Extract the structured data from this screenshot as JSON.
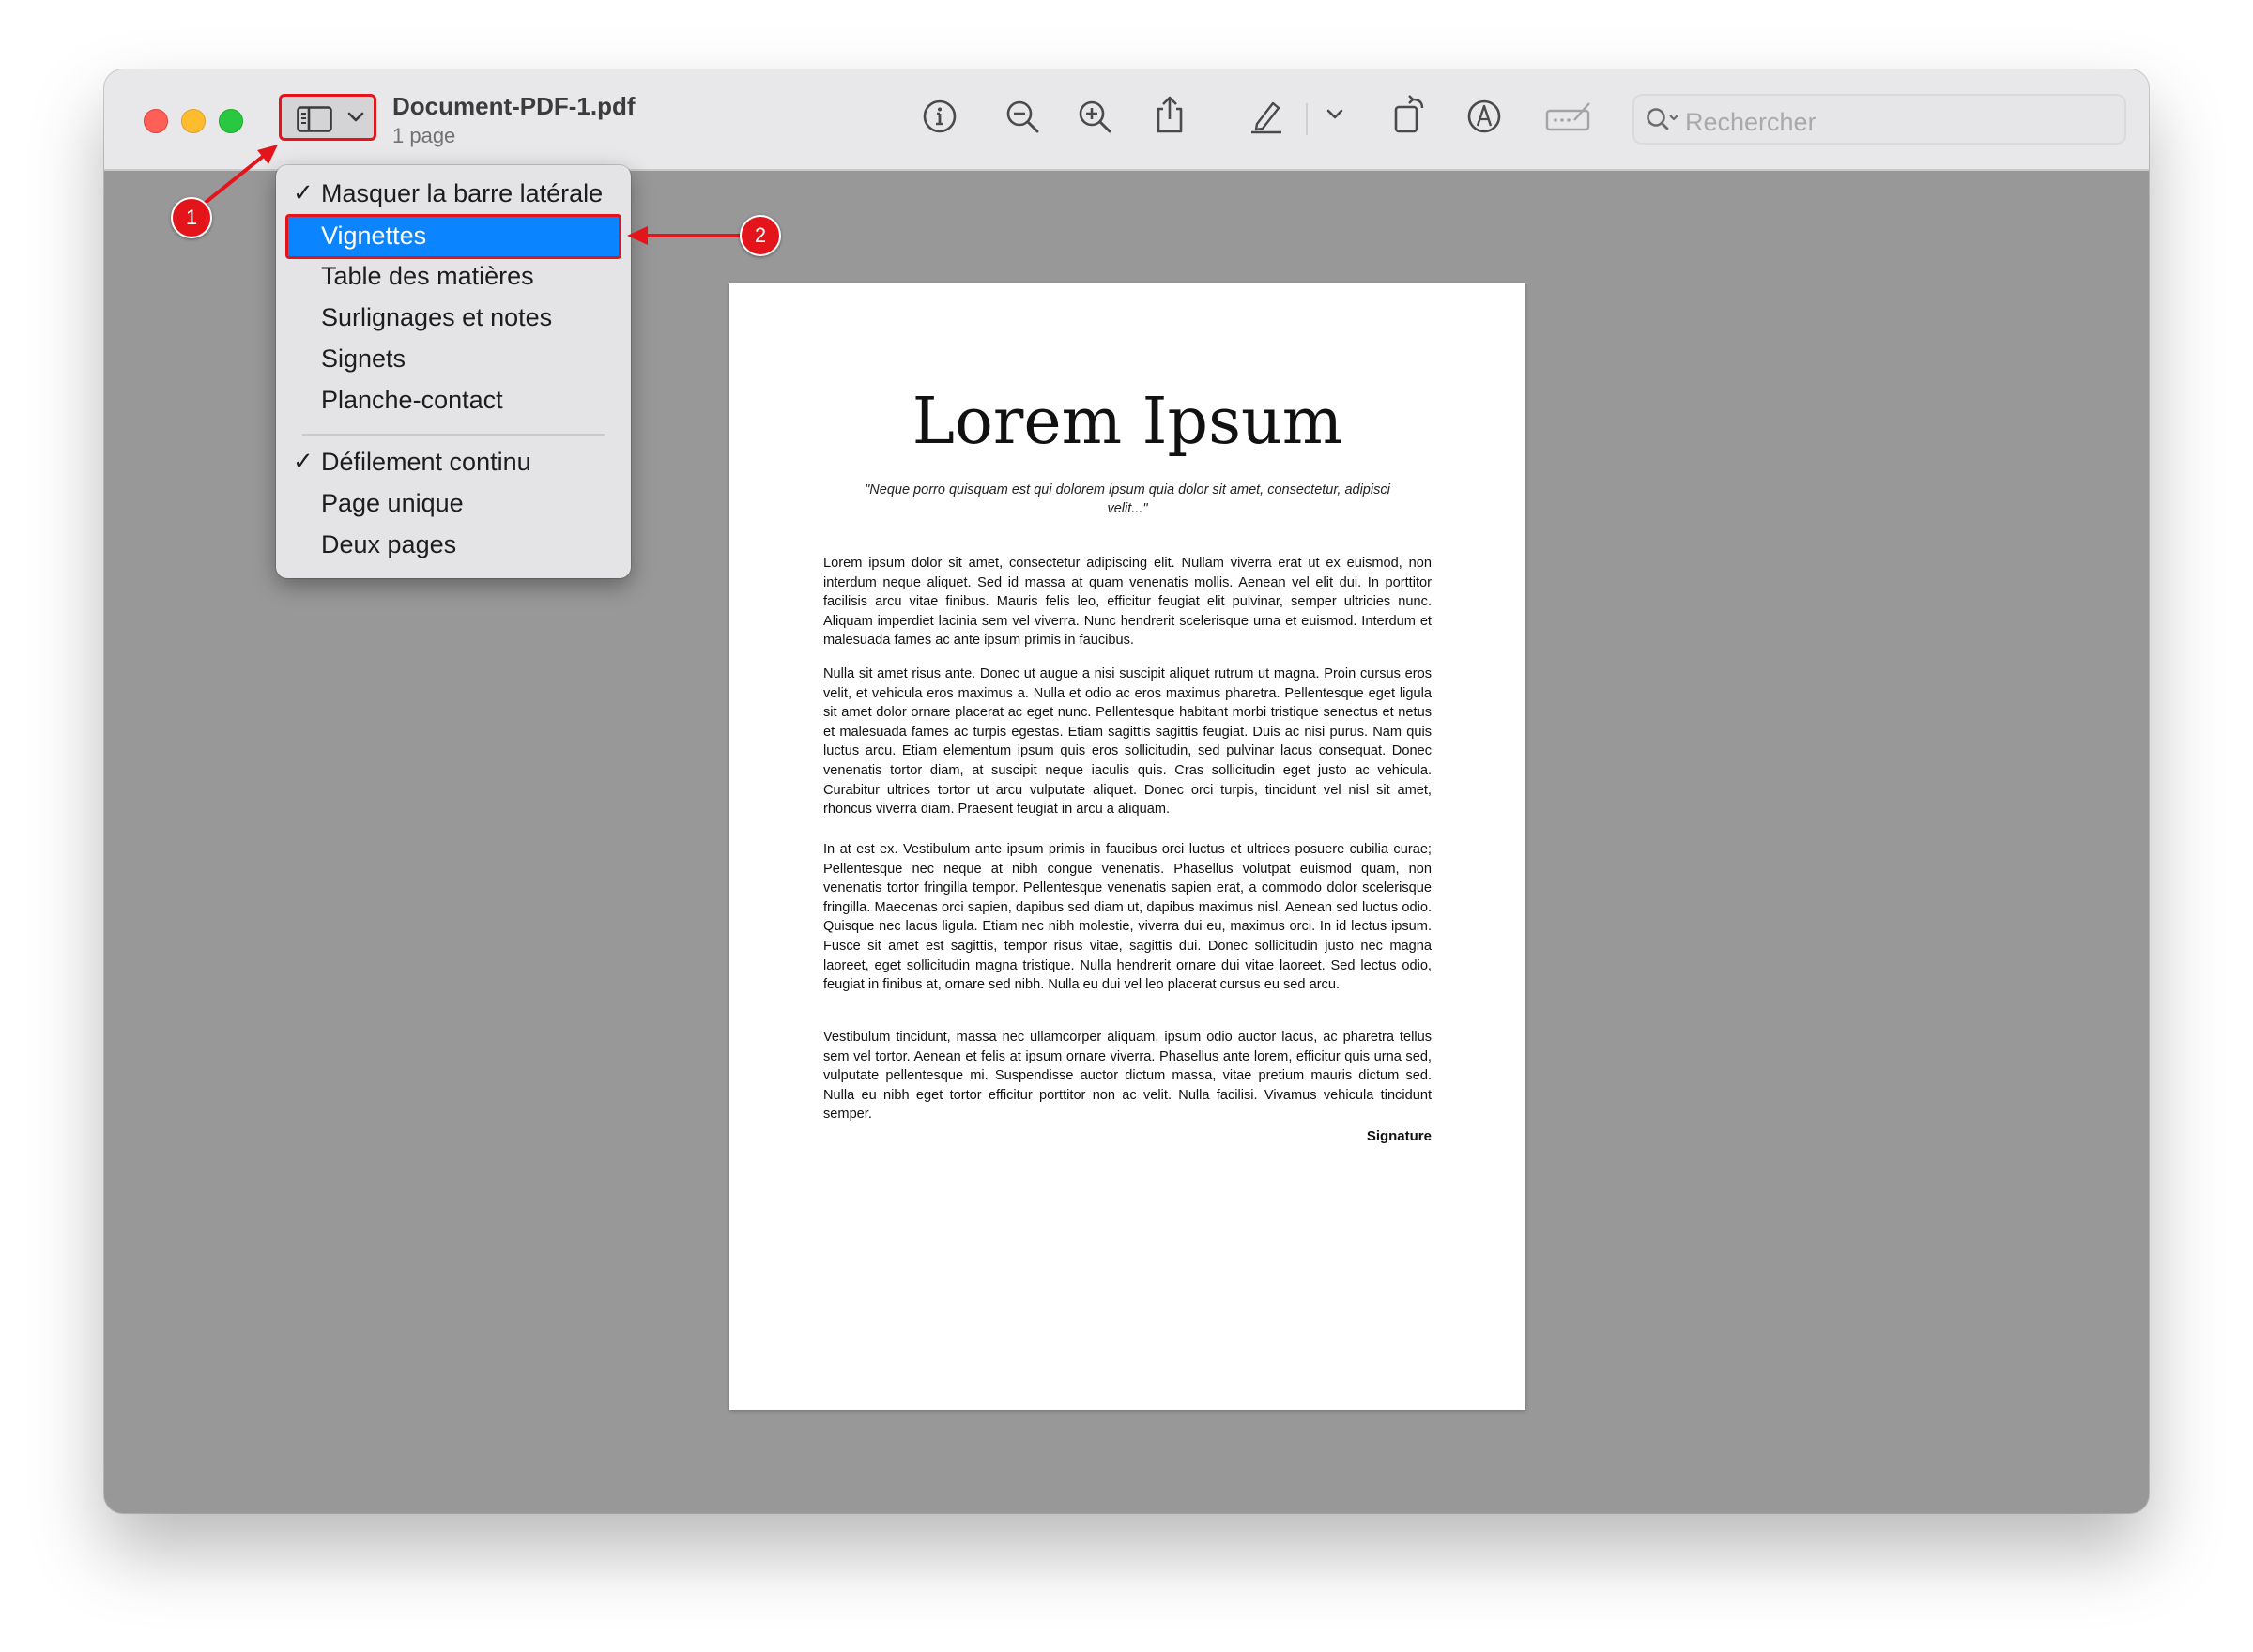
{
  "window": {
    "title": "Document-PDF-1.pdf",
    "subtitle": "1 page"
  },
  "toolbar": {
    "icons": [
      "sidebar-icon",
      "info-icon",
      "zoom-out-icon",
      "zoom-in-icon",
      "share-icon",
      "highlight-icon",
      "rotate-icon",
      "markup-icon",
      "signature-icon",
      "search-icon"
    ],
    "search_placeholder": "Rechercher"
  },
  "menu": {
    "items": [
      {
        "label": "Masquer la barre latérale",
        "checked": true
      },
      {
        "label": "Vignettes",
        "highlighted": true
      },
      {
        "label": "Table des matières"
      },
      {
        "label": "Surlignages et notes"
      },
      {
        "label": "Signets"
      },
      {
        "label": "Planche-contact"
      },
      {
        "label": "Défilement continu",
        "checked": true
      },
      {
        "label": "Page unique"
      },
      {
        "label": "Deux pages"
      }
    ],
    "check_glyph": "✓"
  },
  "document": {
    "title": "Lorem Ipsum",
    "quote": "\"Neque porro quisquam est qui dolorem ipsum quia dolor sit amet, consectetur, adipisci velit...\"",
    "paragraphs": [
      "Lorem ipsum dolor sit amet, consectetur adipiscing elit. Nullam viverra erat ut ex euismod, non interdum neque aliquet. Sed id massa at quam venenatis mollis. Aenean vel elit dui. In porttitor facilisis arcu vitae finibus. Mauris felis leo, efficitur feugiat elit pulvinar, semper ultricies nunc. Aliquam imperdiet lacinia sem vel viverra. Nunc hendrerit scelerisque urna et euismod. Interdum et malesuada fames ac ante ipsum primis in faucibus.",
      "Nulla sit amet risus ante. Donec ut augue a nisi suscipit aliquet rutrum ut magna. Proin cursus eros velit, et vehicula eros maximus a. Nulla et odio ac eros maximus pharetra. Pellentesque eget ligula sit amet dolor ornare placerat ac eget nunc. Pellentesque habitant morbi tristique senectus et netus et malesuada fames ac turpis egestas. Etiam sagittis sagittis feugiat. Duis ac nisi purus. Nam quis luctus arcu. Etiam elementum ipsum quis eros sollicitudin, sed pulvinar lacus consequat. Donec venenatis tortor diam, at suscipit neque iaculis quis. Cras sollicitudin eget justo ac vehicula. Curabitur ultrices tortor ut arcu vulputate aliquet. Donec orci turpis, tincidunt vel nisl sit amet, rhoncus viverra diam. Praesent feugiat in arcu a aliquam.",
      "In at est ex. Vestibulum ante ipsum primis in faucibus orci luctus et ultrices posuere cubilia curae; Pellentesque nec neque at nibh congue venenatis. Phasellus volutpat euismod quam, non venenatis tortor fringilla tempor. Pellentesque venenatis sapien erat, a commodo dolor scelerisque fringilla. Maecenas orci sapien, dapibus sed diam ut, dapibus maximus nisl. Aenean sed luctus odio. Quisque nec lacus ligula. Etiam nec nibh molestie, viverra dui eu, maximus orci. In id lectus ipsum. Fusce sit amet est sagittis, tempor risus vitae, sagittis dui. Donec sollicitudin justo nec magna laoreet, eget sollicitudin magna tristique. Nulla hendrerit ornare dui vitae laoreet. Sed lectus odio, feugiat in finibus at, ornare sed nibh. Nulla eu dui vel leo placerat cursus eu sed arcu.",
      "Vestibulum tincidunt, massa nec ullamcorper aliquam, ipsum odio auctor lacus, ac pharetra tellus sem vel tortor. Aenean et felis at ipsum ornare viverra. Phasellus ante lorem, efficitur quis urna sed, vulputate pellentesque mi. Suspendisse auctor dictum massa, vitae pretium mauris dictum sed. Nulla eu nibh eget tortor efficitur porttitor non ac velit. Nulla facilisi. Vivamus vehicula tincidunt semper."
    ],
    "signature": "Signature"
  },
  "annotations": {
    "badge1": "1",
    "badge2": "2",
    "color": "#e3151b"
  }
}
